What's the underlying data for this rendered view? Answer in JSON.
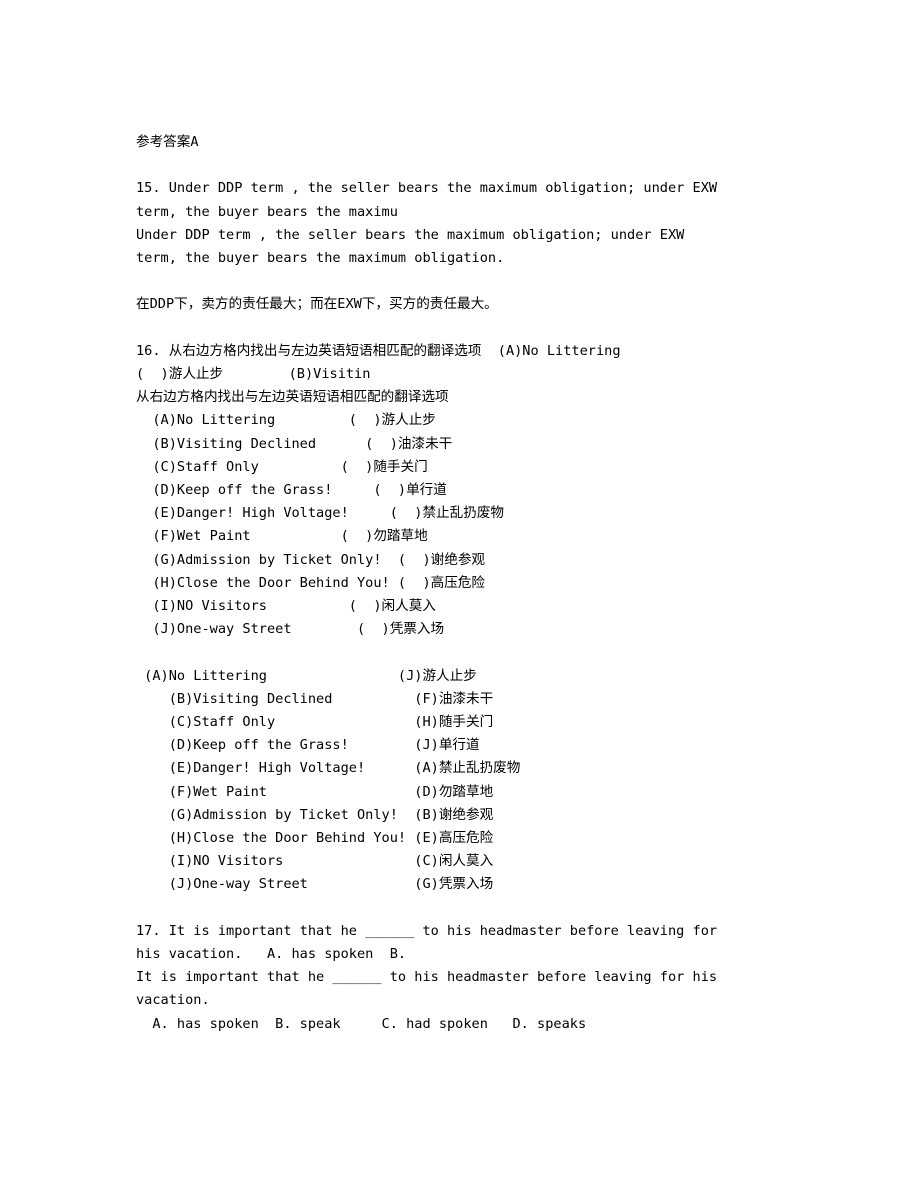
{
  "document": {
    "header": {
      "reference_answer": "参考答案A"
    },
    "question_15": {
      "stem_lines": [
        "15. Under DDP term , the seller bears the maximum obligation; under EXW",
        "term, the buyer bears the maximu"
      ],
      "restatement_lines": [
        "Under DDP term , the seller bears the maximum obligation; under EXW",
        "term, the buyer bears the maximum obligation."
      ],
      "answer_cn": "在DDP下，卖方的责任最大；而在EXW下，买方的责任最大。"
    },
    "question_16": {
      "stem_lines": [
        "16. 从右边方格内找出与左边英语短语相匹配的翻译选项  (A)No Littering",
        "(  )游人止步        (B)Visitin"
      ],
      "restatement": "从右边方格内找出与左边英语短语相匹配的翻译选项",
      "exercise_rows": [
        {
          "label": "(A)",
          "english": "No Littering",
          "marker": "(  )",
          "chinese": "游人止步",
          "line": "  (A)No Littering         (  )游人止步"
        },
        {
          "label": "(B)",
          "english": "Visiting Declined",
          "marker": "(  )",
          "chinese": "油漆未干",
          "line": "  (B)Visiting Declined      (  )油漆未干"
        },
        {
          "label": "(C)",
          "english": "Staff Only",
          "marker": "(  )",
          "chinese": "随手关门",
          "line": "  (C)Staff Only          (  )随手关门"
        },
        {
          "label": "(D)",
          "english": "Keep off the Grass!",
          "marker": "(  )",
          "chinese": "单行道",
          "line": "  (D)Keep off the Grass!     (  )单行道"
        },
        {
          "label": "(E)",
          "english": "Danger! High Voltage!",
          "marker": "(  )",
          "chinese": "禁止乱扔废物",
          "line": "  (E)Danger! High Voltage!     (  )禁止乱扔废物"
        },
        {
          "label": "(F)",
          "english": "Wet Paint",
          "marker": "(  )",
          "chinese": "勿踏草地",
          "line": "  (F)Wet Paint           (  )勿踏草地"
        },
        {
          "label": "(G)",
          "english": "Admission by Ticket Only!",
          "marker": "(  )",
          "chinese": "谢绝参观",
          "line": "  (G)Admission by Ticket Only!  (  )谢绝参观"
        },
        {
          "label": "(H)",
          "english": "Close the Door Behind You!",
          "marker": "(  )",
          "chinese": "高压危险",
          "line": "  (H)Close the Door Behind You! (  )高压危险"
        },
        {
          "label": "(I)",
          "english": "NO Visitors",
          "marker": "(  )",
          "chinese": "闲人莫入",
          "line": "  (I)NO Visitors          (  )闲人莫入"
        },
        {
          "label": "(J)",
          "english": "One-way Street",
          "marker": "(  )",
          "chinese": "凭票入场",
          "line": "  (J)One-way Street        (  )凭票入场"
        }
      ],
      "answer_rows": [
        {
          "label": "(A)",
          "english": "No Littering",
          "answer": "(J)",
          "chinese": "游人止步",
          "line": " (A)No Littering                (J)游人止步"
        },
        {
          "label": "(B)",
          "english": "Visiting Declined",
          "answer": "(F)",
          "chinese": "油漆未干",
          "line": "    (B)Visiting Declined          (F)油漆未干"
        },
        {
          "label": "(C)",
          "english": "Staff Only",
          "answer": "(H)",
          "chinese": "随手关门",
          "line": "    (C)Staff Only                 (H)随手关门"
        },
        {
          "label": "(D)",
          "english": "Keep off the Grass!",
          "answer": "(J)",
          "chinese": "单行道",
          "line": "    (D)Keep off the Grass!        (J)单行道"
        },
        {
          "label": "(E)",
          "english": "Danger! High Voltage!",
          "answer": "(A)",
          "chinese": "禁止乱扔废物",
          "line": "    (E)Danger! High Voltage!      (A)禁止乱扔废物"
        },
        {
          "label": "(F)",
          "english": "Wet Paint",
          "answer": "(D)",
          "chinese": "勿踏草地",
          "line": "    (F)Wet Paint                  (D)勿踏草地"
        },
        {
          "label": "(G)",
          "english": "Admission by Ticket Only!",
          "answer": "(B)",
          "chinese": "谢绝参观",
          "line": "    (G)Admission by Ticket Only!  (B)谢绝参观"
        },
        {
          "label": "(H)",
          "english": "Close the Door Behind You!",
          "answer": "(E)",
          "chinese": "高压危险",
          "line": "    (H)Close the Door Behind You! (E)高压危险"
        },
        {
          "label": "(I)",
          "english": "NO Visitors",
          "answer": "(C)",
          "chinese": "闲人莫入",
          "line": "    (I)NO Visitors                (C)闲人莫入"
        },
        {
          "label": "(J)",
          "english": "One-way Street",
          "answer": "(G)",
          "chinese": "凭票入场",
          "line": "    (J)One-way Street             (G)凭票入场"
        }
      ]
    },
    "question_17": {
      "stem_lines": [
        "17. It is important that he ______ to his headmaster before leaving for",
        "his vacation.   A. has spoken  B."
      ],
      "restatement_lines": [
        "It is important that he ______ to his headmaster before leaving for his",
        "vacation."
      ],
      "choices_line": "  A. has spoken  B. speak     C. had spoken   D. speaks",
      "choices": [
        {
          "label": "A.",
          "text": "has spoken"
        },
        {
          "label": "B.",
          "text": "speak"
        },
        {
          "label": "C.",
          "text": "had spoken"
        },
        {
          "label": "D.",
          "text": "speaks"
        }
      ]
    }
  }
}
